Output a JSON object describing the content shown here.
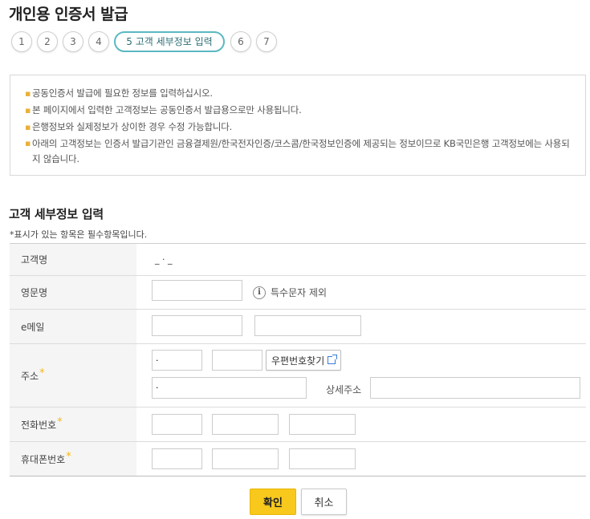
{
  "page": {
    "title": "개인용 인증서 발급"
  },
  "steps": [
    {
      "label": "1"
    },
    {
      "label": "2"
    },
    {
      "label": "3"
    },
    {
      "label": "4"
    },
    {
      "label": "5 고객 세부정보 입력",
      "active": true
    },
    {
      "label": "6"
    },
    {
      "label": "7"
    }
  ],
  "notice": {
    "items": [
      "공동인증서 발급에 필요한 정보를 입력하십시오.",
      "본 페이지에서 입력한 고객정보는 공동인증서 발급용으로만 사용됩니다.",
      "은행정보와 실제정보가 상이한 경우 수정 가능합니다.",
      "아래의 고객정보는 인증서 발급기관인 금융결제원/한국전자인증/코스콤/한국정보인증에 제공되는 정보이므로 KB국민은행 고객정보에는 사용되지 않습니다."
    ]
  },
  "form": {
    "section_title": "고객 세부정보 입력",
    "required_note": "*표시가 있는 항목은 필수항목입니다.",
    "required_mark": "*",
    "name": {
      "label": "고객명",
      "value": "_ · _"
    },
    "english_name": {
      "label": "영문명",
      "value": "",
      "hint": "특수문자 제외",
      "hint_icon": "info-icon"
    },
    "email": {
      "label": "e메일",
      "local_value": "",
      "domain_value": ""
    },
    "address": {
      "label": "주소",
      "zip1": "·",
      "zip2": "",
      "zip_button": "우편번호찾기",
      "zip_button_icon": "external-link-icon",
      "base_address": "·",
      "detail_label": "상세주소",
      "detail_value": ""
    },
    "phone": {
      "label": "전화번호",
      "part1": "",
      "part2": "",
      "part3": ""
    },
    "mobile": {
      "label": "휴대폰번호",
      "part1": "",
      "part2": "",
      "part3": ""
    }
  },
  "buttons": {
    "confirm": "확인",
    "cancel": "취소"
  },
  "colors": {
    "accent_yellow": "#f8c81c",
    "active_step_border": "#5bb8c2",
    "required_star": "#f5b81b",
    "label_bg": "#f5f5f5"
  }
}
